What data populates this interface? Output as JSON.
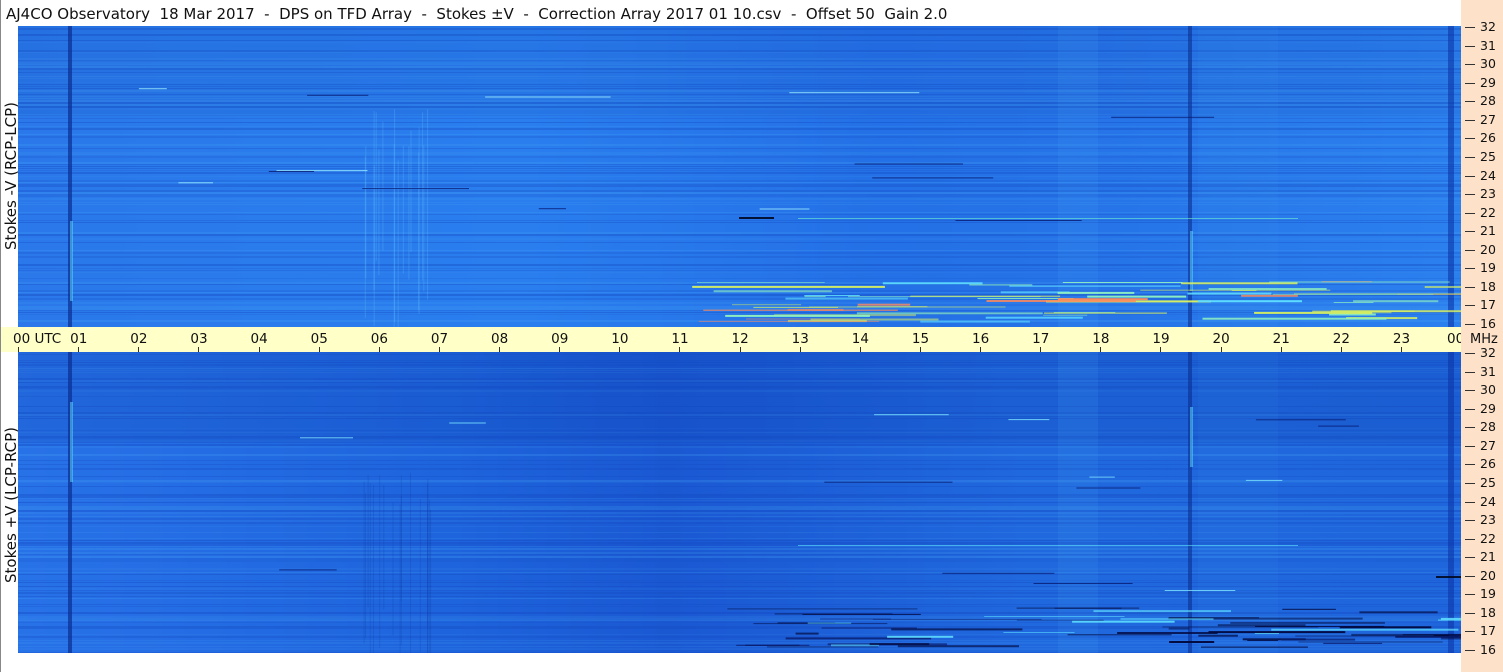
{
  "header": {
    "title": "AJ4CO Observatory  18 Mar 2017  -  DPS on TFD Array  -  Stokes ±V  -  Correction Array 2017 01 10.csv  -  Offset 50  Gain 2.0"
  },
  "panels": {
    "top_label": "Stokes -V (RCP-LCP)",
    "bottom_label": "Stokes +V (LCP-RCP)"
  },
  "time_axis": {
    "labels": [
      "00 UTC",
      "01",
      "02",
      "03",
      "04",
      "05",
      "06",
      "07",
      "08",
      "09",
      "10",
      "11",
      "12",
      "13",
      "14",
      "15",
      "16",
      "17",
      "18",
      "19",
      "20",
      "21",
      "22",
      "23",
      "00"
    ]
  },
  "freq_axis": {
    "labels": [
      "32",
      "31",
      "30",
      "29",
      "28",
      "27",
      "26",
      "25",
      "24",
      "23",
      "22",
      "21",
      "20",
      "19",
      "18",
      "17",
      "16"
    ],
    "unit": "MHz"
  },
  "colors": {
    "spectrogram_base": "#1f6fe6",
    "spectrogram_dark": "#0d3fb0",
    "spectrogram_bright": "#3fb3f5",
    "time_strip": "#ffffc8",
    "freq_axis_bg": "#fde1c8"
  }
}
